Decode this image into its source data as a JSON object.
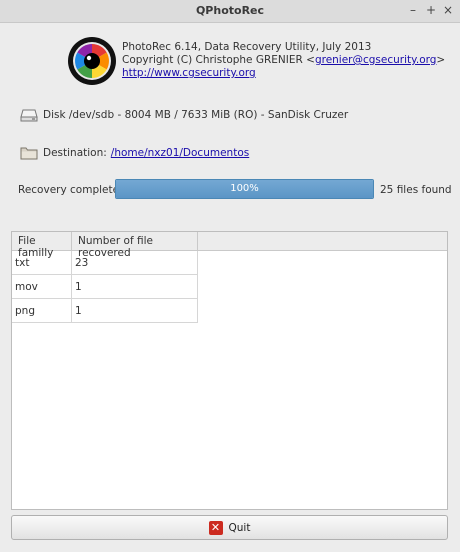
{
  "window": {
    "title": "QPhotoRec",
    "controls": [
      "minimize-icon",
      "maximize-icon",
      "close-icon"
    ]
  },
  "header": {
    "logo_icon": "photorec-logo-icon",
    "line1": "PhotoRec 6.14, Data Recovery Utility, July 2013",
    "line2_prefix": "Copyright (C) Christophe GRENIER <",
    "email": "grenier@cgsecurity.org",
    "line2_suffix": ">",
    "website": "http://www.cgsecurity.org"
  },
  "disk": {
    "icon": "disk-drive-icon",
    "label": "Disk /dev/sdb - 8004 MB / 7633 MiB (RO) - SanDisk Cruzer"
  },
  "destination": {
    "icon": "folder-icon",
    "label": "Destination:",
    "path": "/home/nxz01/Documentos"
  },
  "progress": {
    "label": "Recovery completed",
    "percent_text": "100%",
    "fraction": 1.0,
    "fill_color": "#5b95c6",
    "files_found": "25 files found"
  },
  "table": {
    "headers": [
      "File familly",
      "Number of file recovered"
    ],
    "rows": [
      [
        "txt",
        "23"
      ],
      [
        "mov",
        "1"
      ],
      [
        "png",
        "1"
      ]
    ]
  },
  "quit_button": {
    "icon": "quit-icon",
    "label": "Quit"
  }
}
